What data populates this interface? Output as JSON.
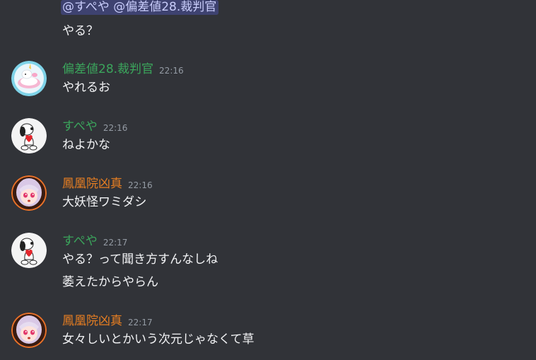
{
  "mention": {
    "text": "@すぺや @偏差値28.裁判官"
  },
  "continuation": {
    "text": "やる？"
  },
  "colors": {
    "background": "#313338",
    "green_user": "#3ba55c",
    "orange_user": "#e67e22",
    "mention_bg": "#3e4270",
    "mention_text": "#c9cdfb"
  },
  "messages": [
    {
      "username": "偏差値28.裁判官",
      "time": "22:16",
      "avatar": "unicorn-avatar",
      "lines": [
        "やれるお"
      ]
    },
    {
      "username": "すぺや",
      "time": "22:16",
      "avatar": "snoopy-avatar",
      "lines": [
        "ねよかな"
      ]
    },
    {
      "username": "鳳凰院凶真",
      "time": "22:16",
      "avatar": "anime-girl-avatar",
      "lines": [
        "大妖怪ワミダシ"
      ]
    },
    {
      "username": "すぺや",
      "time": "22:17",
      "avatar": "snoopy-avatar",
      "lines": [
        "やる？って聞き方すんなしね",
        "萎えたからやらん"
      ]
    },
    {
      "username": "鳳凰院凶真",
      "time": "22:17",
      "avatar": "anime-girl-avatar",
      "lines": [
        "女々しいとかいう次元じゃなくて草"
      ]
    }
  ]
}
